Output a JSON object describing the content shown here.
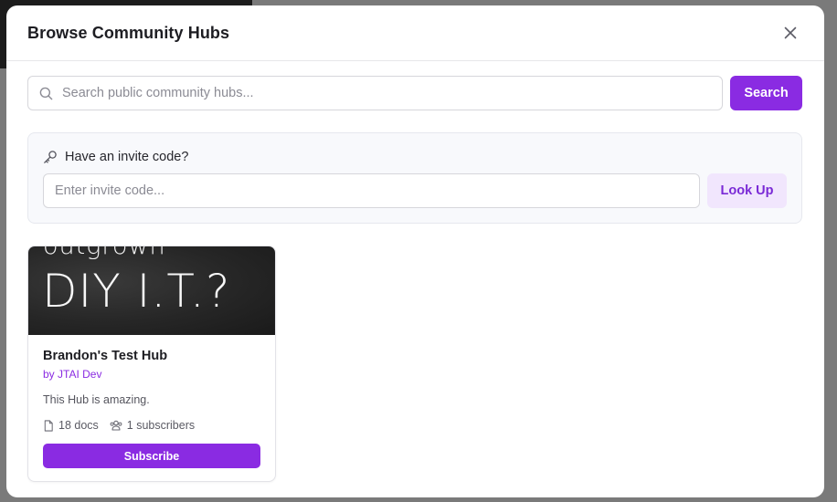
{
  "modal": {
    "title": "Browse Community Hubs"
  },
  "search": {
    "placeholder": "Search public community hubs...",
    "value": "",
    "button_label": "Search"
  },
  "invite": {
    "label": "Have an invite code?",
    "placeholder": "Enter invite code...",
    "value": "",
    "button_label": "Look Up"
  },
  "hubs": [
    {
      "banner_line1": "outgrown",
      "banner_line2": "DIY I.T.?",
      "name": "Brandon's Test Hub",
      "author": "by JTAI Dev",
      "description": "This Hub is amazing.",
      "docs": "18 docs",
      "subscribers": "1 subscribers",
      "subscribe_label": "Subscribe"
    }
  ],
  "colors": {
    "accent": "#8a2be2",
    "accent_light": "#f1e6fd",
    "backdrop": "#7a7a7a"
  },
  "icons": {
    "close": "close-icon",
    "search": "search-icon",
    "key": "key-icon",
    "doc": "document-icon",
    "subscribers": "users-icon"
  }
}
